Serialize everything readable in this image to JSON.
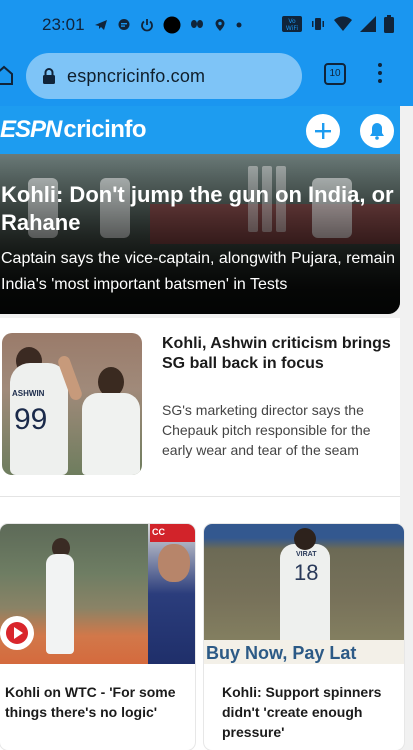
{
  "status_bar": {
    "time": "23:01",
    "left_icons": [
      "telegram-icon",
      "chat-icon",
      "power-icon",
      "dot-icon",
      "butterfly-icon",
      "location-icon",
      "small-dot-icon"
    ],
    "right_icons": [
      "vowifi-icon",
      "vibrate-icon",
      "wifi-icon",
      "signal-icon",
      "battery-icon"
    ],
    "vowifi_label": "Vo WiFi"
  },
  "browser": {
    "url": "espncricinfo.com",
    "tab_count": "10"
  },
  "site_header": {
    "logo_espn": "ESPN",
    "logo_cricinfo": "cricinfo"
  },
  "hero": {
    "title": "Kohli: Don't jump the gun on India, or Rahane",
    "subtitle": "Captain says the vice-captain, alongwith Pujara, remain India's 'most important batsmen' in Tests"
  },
  "story2": {
    "title": "Kohli, Ashwin criticism brings SG ball back in focus",
    "subtitle": "SG's marketing director says the Chepauk pitch responsible for the early wear and tear of the seam",
    "image_jersey_name": "ASHWIN",
    "image_jersey_number": "99"
  },
  "cards": [
    {
      "title": "Kohli on WTC - 'For some things there's no logic'",
      "image_tag": "CC",
      "is_video": true
    },
    {
      "title": "Kohli: Support spinners didn't 'create enough pressure'",
      "image_jersey_name": "VIRAT",
      "image_jersey_number": "18",
      "image_banner": "Buy Now, Pay Lat"
    }
  ],
  "colors": {
    "chrome_blue": "#1a96f0",
    "url_pill": "#7ec4f7",
    "header_blue": "#1d9cf0",
    "video_red": "#d9262c"
  }
}
